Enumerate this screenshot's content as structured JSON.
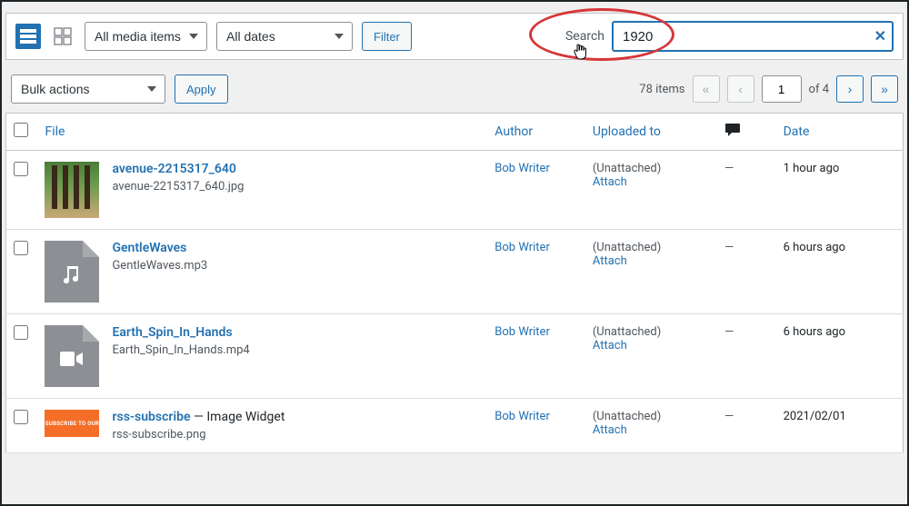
{
  "toolbar": {
    "media_filter": "All media items",
    "date_filter": "All dates",
    "filter_btn": "Filter",
    "search_label": "Search",
    "search_value": "1920"
  },
  "subbar": {
    "bulk": "Bulk actions",
    "apply": "Apply",
    "items_count": "78 items",
    "page_current": "1",
    "page_of": "of 4"
  },
  "columns": {
    "file": "File",
    "author": "Author",
    "uploaded_to": "Uploaded to",
    "date": "Date"
  },
  "rows": [
    {
      "thumb_type": "img",
      "title": "avenue-2215317_640",
      "title_suffix": "",
      "filename": "avenue-2215317_640.jpg",
      "author": "Bob Writer",
      "parent": "(Unattached)",
      "attach": "Attach",
      "comments": "—",
      "date": "1 hour ago"
    },
    {
      "thumb_type": "audio",
      "title": "GentleWaves",
      "title_suffix": "",
      "filename": "GentleWaves.mp3",
      "author": "Bob Writer",
      "parent": "(Unattached)",
      "attach": "Attach",
      "comments": "—",
      "date": "6 hours ago"
    },
    {
      "thumb_type": "video",
      "title": "Earth_Spin_In_Hands",
      "title_suffix": "",
      "filename": "Earth_Spin_In_Hands.mp4",
      "author": "Bob Writer",
      "parent": "(Unattached)",
      "attach": "Attach",
      "comments": "—",
      "date": "6 hours ago"
    },
    {
      "thumb_type": "orange",
      "thumb_text": "SUBSCRIBE TO OUR",
      "title": "rss-subscribe",
      "title_suffix": " — Image Widget",
      "filename": "rss-subscribe.png",
      "author": "Bob Writer",
      "parent": "(Unattached)",
      "attach": "Attach",
      "comments": "—",
      "date": "2021/02/01"
    }
  ]
}
